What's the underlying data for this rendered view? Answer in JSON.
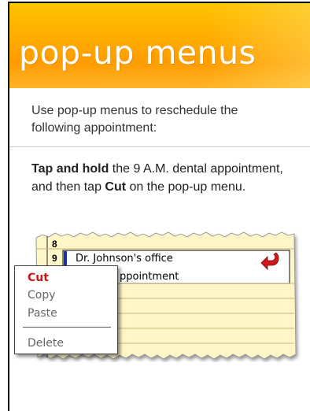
{
  "banner": {
    "title": "pop-up menus"
  },
  "intro": {
    "text": "Use pop-up menus to reschedule the following appointment:"
  },
  "instruction": {
    "bold_1": "Tap and hold",
    "text_1": " the 9 A.M. dental appointment, and then tap ",
    "bold_2": "Cut",
    "text_2": " on the pop-up menu."
  },
  "calendar": {
    "hour_8": "8",
    "hour_9": "9",
    "appointment_line1": "Dr. Johnson's office",
    "appointment_line2": "ppointment"
  },
  "popup_menu": {
    "items": [
      {
        "label": "Cut"
      },
      {
        "label": "Copy"
      },
      {
        "label": "Paste"
      },
      {
        "label": "Delete"
      }
    ]
  },
  "colors": {
    "banner": "#ffb000",
    "cut_highlight": "#d41616",
    "calendar_paper": "#fff6c8",
    "appointment_marker": "#1a33a8",
    "undo_arrow": "#d01818"
  }
}
